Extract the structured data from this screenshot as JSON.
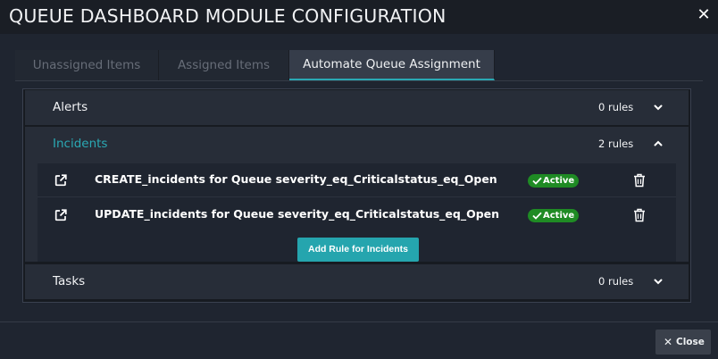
{
  "modal": {
    "title": "QUEUE DASHBOARD MODULE CONFIGURATION",
    "close_icon": "close-icon"
  },
  "tabs": [
    {
      "label": "Unassigned Items",
      "active": false
    },
    {
      "label": "Assigned Items",
      "active": false
    },
    {
      "label": "Automate Queue Assignment",
      "active": true
    }
  ],
  "sections": {
    "alerts": {
      "title": "Alerts",
      "count": "0 rules",
      "expanded": false
    },
    "incidents": {
      "title": "Incidents",
      "count": "2 rules",
      "expanded": true,
      "rules": [
        {
          "name": "CREATE_incidents for Queue severity_eq_Criticalstatus_eq_Open",
          "status": "Active"
        },
        {
          "name": "UPDATE_incidents for Queue severity_eq_Criticalstatus_eq_Open",
          "status": "Active"
        }
      ],
      "add_rule_label": "Add Rule for Incidents"
    },
    "tasks": {
      "title": "Tasks",
      "count": "0 rules",
      "expanded": false
    }
  },
  "footer": {
    "close_label": "Close"
  },
  "colors": {
    "accent": "#2aa9b4",
    "active_badge": "#1f8b24",
    "background": "#1f2530"
  }
}
